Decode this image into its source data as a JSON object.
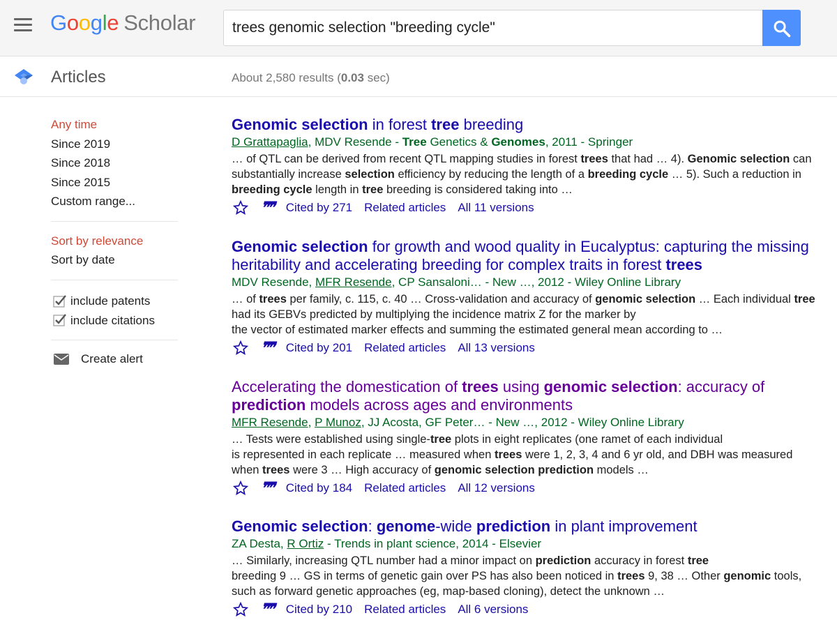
{
  "header": {
    "logo_letters": [
      "G",
      "o",
      "o",
      "g",
      "l",
      "e"
    ],
    "logo_product": "Scholar",
    "search_value": "trees genomic selection \"breeding cycle\""
  },
  "subheader": {
    "section_label": "Articles",
    "results_prefix": "About 2,580 results (",
    "results_time": "0.03",
    "results_suffix": " sec)"
  },
  "sidebar": {
    "time_filters": [
      "Any time",
      "Since 2019",
      "Since 2018",
      "Since 2015",
      "Custom range..."
    ],
    "sort_options": [
      "Sort by relevance",
      "Sort by date"
    ],
    "checkboxes": [
      "include patents",
      "include citations"
    ],
    "create_alert": "Create alert"
  },
  "results": [
    {
      "title_html": "<b>Genomic selection</b> in forest <b>tree</b> breeding",
      "authors_html": "<u>D Grattapaglia</u>, MDV Resende - <b>Tree</b> Genetics &amp; <b>Genomes</b>, 2011 - Springer",
      "snippet_html": "… of QTL can be derived from recent QTL mapping studies in forest <b>trees</b> that had … 4). <b>Genomic selection</b> can substantially increase <b>selection</b> efficiency by reducing the length of a <b>breeding cycle</b> … 5). Such a reduction in <b>breeding cycle</b> length in <b>tree</b> breeding is considered taking into …",
      "cited": "Cited by 271",
      "related": "Related articles",
      "versions": "All 11 versions",
      "visited": false
    },
    {
      "title_html": "<b>Genomic selection</b> for growth and wood quality in Eucalyptus: capturing the missing heritability and accelerating breeding for complex traits in forest <b>trees</b>",
      "authors_html": "MDV Resende, <u>MFR Resende</u>, CP Sansaloni… - New …, 2012 - Wiley Online Library",
      "snippet_html": "… of <b>trees</b> per family, c. 115, c. 40 … Cross-validation and accuracy of <b>genomic selection</b> … Each individual <b>tree</b> had its GEBVs predicted by multiplying the incidence matrix Z for the marker by<br>the vector of estimated marker effects and summing the estimated general mean according to …",
      "cited": "Cited by 201",
      "related": "Related articles",
      "versions": "All 13 versions",
      "visited": false
    },
    {
      "title_html": "Accelerating the domestication of <b>trees</b> using <b>genomic selection</b>: accuracy of <b>prediction</b> models across ages and environments",
      "authors_html": "<u>MFR Resende</u>, <u>P Munoz</u>, JJ Acosta, GF Peter… - New …, 2012 - Wiley Online Library",
      "snippet_html": "… Tests were established using single-<b>tree</b> plots in eight replicates (one ramet of each individual<br>is represented in each replicate … measured when <b>trees</b> were 1, 2, 3, 4 and 6 yr old, and DBH was measured when <b>trees</b> were 3 … High accuracy of <b>genomic selection prediction</b> models …",
      "cited": "Cited by 184",
      "related": "Related articles",
      "versions": "All 12 versions",
      "visited": true
    },
    {
      "title_html": "<b>Genomic selection</b>: <b>genome</b>-wide <b>prediction</b> in plant improvement",
      "authors_html": "ZA Desta, <u>R Ortiz</u> - Trends in plant science, 2014 - Elsevier",
      "snippet_html": "… Similarly, increasing QTL number had a minor impact on <b>prediction</b> accuracy in forest <b>tree</b><br>breeding 9 … GS in terms of genetic gain over PS has also been noticed in <b>trees</b> 9, 38 … Other <b>genomic</b> tools, such as forward genetic approaches (eg, map-based cloning), detect the unknown …",
      "cited": "Cited by 210",
      "related": "Related articles",
      "versions": "All 6 versions",
      "visited": false
    }
  ]
}
